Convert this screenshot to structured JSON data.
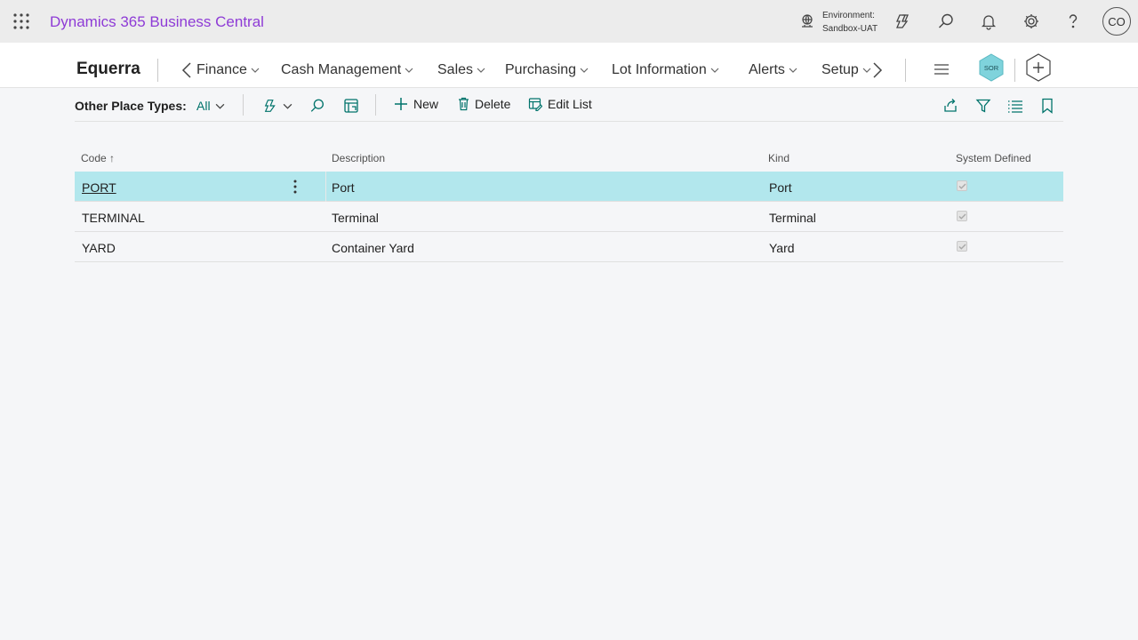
{
  "appbar": {
    "title": "Dynamics 365 Business Central",
    "environment_label": "Environment:",
    "environment_value": "Sandbox-UAT",
    "avatar_initials": "CO",
    "icons": [
      "waffle-icon",
      "environment-icon",
      "copilot-icon",
      "search-icon",
      "bell-icon",
      "gear-icon",
      "help-icon"
    ]
  },
  "navbar": {
    "company": "Equerra",
    "items": [
      "Finance",
      "Cash Management",
      "Sales",
      "Purchasing",
      "Lot Information",
      "Alerts",
      "Setup"
    ],
    "badge": "SOR"
  },
  "actionbar": {
    "label": "Other Place Types:",
    "filter": "All",
    "new": "New",
    "delete": "Delete",
    "edit_list": "Edit List"
  },
  "grid": {
    "columns": [
      "Code",
      "Description",
      "Kind",
      "System Defined"
    ],
    "sort_indicator": "↑",
    "rows": [
      {
        "code": "PORT",
        "description": "Port",
        "kind": "Port",
        "system_defined": true
      },
      {
        "code": "TERMINAL",
        "description": "Terminal",
        "kind": "Terminal",
        "system_defined": true
      },
      {
        "code": "YARD",
        "description": "Container Yard",
        "kind": "Yard",
        "system_defined": true
      }
    ]
  },
  "colors": {
    "app_title": "#8e3bd6",
    "accent": "#00736b",
    "selected_row": "#b2e7ed"
  }
}
